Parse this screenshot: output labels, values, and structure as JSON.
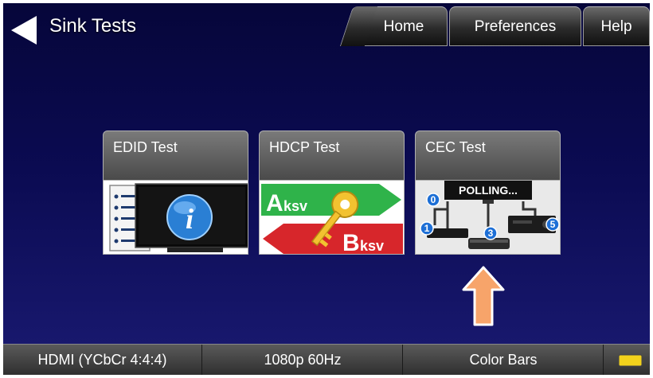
{
  "header": {
    "back_icon": "back-arrow-icon",
    "title": "Sink Tests",
    "tabs": [
      {
        "label": "Home"
      },
      {
        "label": "Preferences"
      },
      {
        "label": "Help"
      }
    ]
  },
  "tiles": [
    {
      "label": "EDID Test",
      "icon": "edid-monitor-info-icon"
    },
    {
      "label": "HDCP Test",
      "icon": "hdcp-key-icon",
      "badge_a": "A",
      "badge_a_sub": "ksv",
      "badge_b": "B",
      "badge_b_sub": "ksv"
    },
    {
      "label": "CEC Test",
      "icon": "cec-devices-icon",
      "polling": "POLLING...",
      "nodes": [
        "0",
        "1",
        "3",
        "5"
      ]
    }
  ],
  "pointer": {
    "icon": "up-arrow-icon",
    "color": "#f7a46a"
  },
  "footer": {
    "signal": "HDMI (YCbCr 4:4:4)",
    "resolution": "1080p 60Hz",
    "pattern": "Color Bars",
    "battery_icon": "battery-icon"
  },
  "colors": {
    "background": "#0b0b52",
    "hdcp_green": "#2fb34a",
    "hdcp_red": "#d7262b",
    "key_gold": "#f2c230",
    "cec_node_blue": "#1d6fd6"
  }
}
